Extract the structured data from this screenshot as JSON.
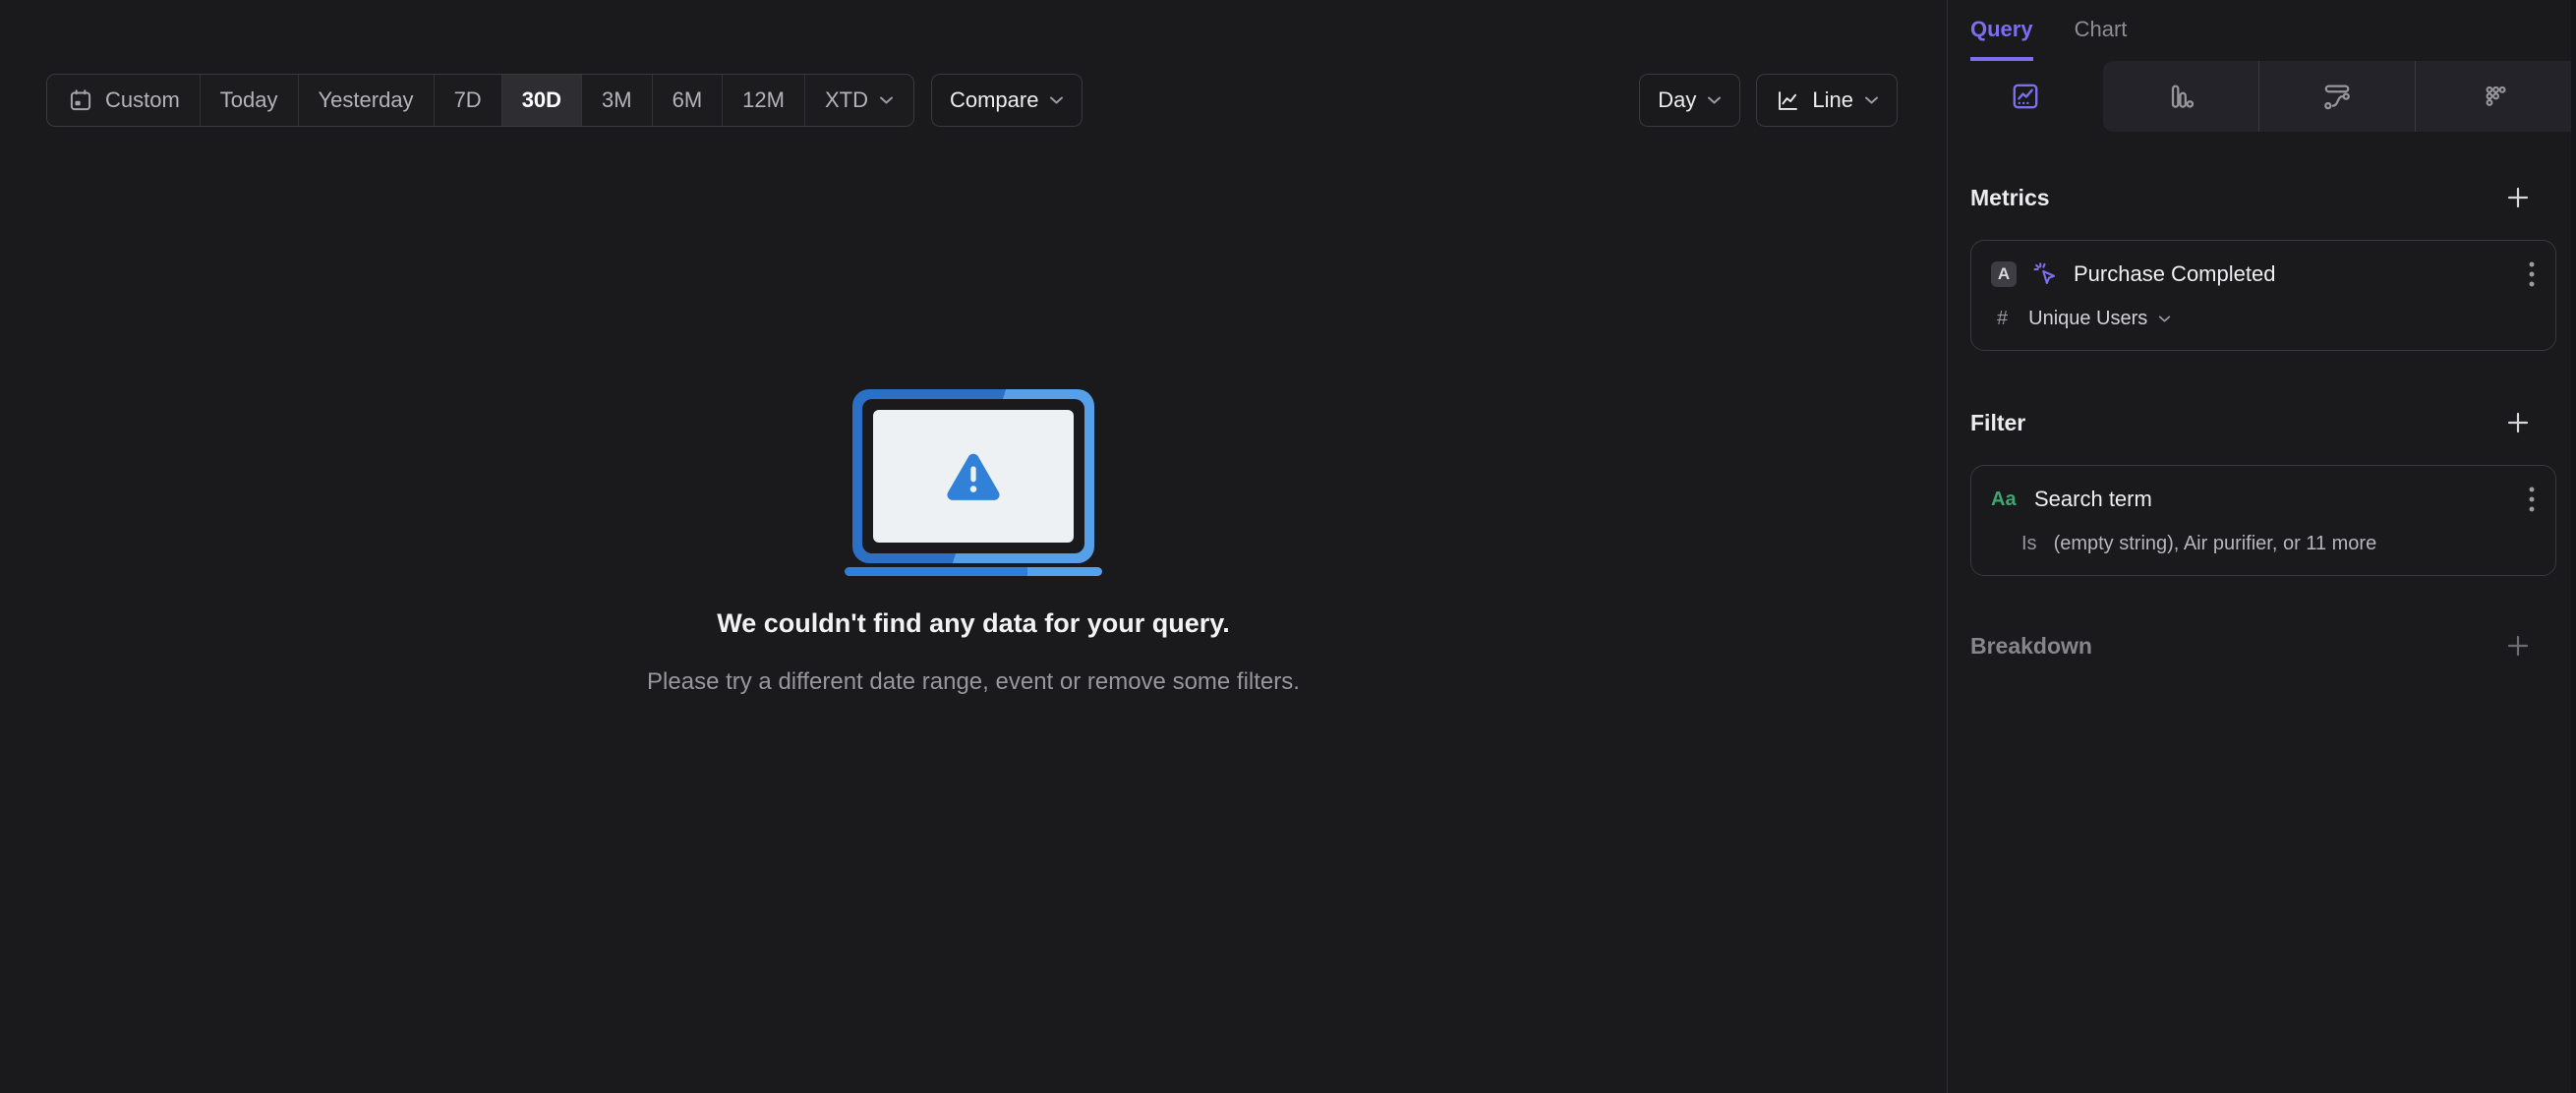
{
  "colors": {
    "accent_purple": "#7b6ff0",
    "property_green": "#3fa573",
    "illustration_blue": "#2f7ed8",
    "illustration_blue_light": "#55a0e8",
    "background": "#1a191c"
  },
  "toolbar": {
    "ranges": [
      {
        "label": "Custom"
      },
      {
        "label": "Today"
      },
      {
        "label": "Yesterday"
      },
      {
        "label": "7D"
      },
      {
        "label": "30D"
      },
      {
        "label": "3M"
      },
      {
        "label": "6M"
      },
      {
        "label": "12M"
      },
      {
        "label": "XTD"
      }
    ],
    "active_range": "30D",
    "compare": {
      "label": "Compare"
    },
    "granularity": {
      "label": "Day"
    },
    "chart_type": {
      "label": "Line"
    }
  },
  "empty_state": {
    "title": "We couldn't find any data for your query.",
    "subtitle": "Please try a different date range, event or remove some filters."
  },
  "sidebar": {
    "tabs": [
      {
        "label": "Query"
      },
      {
        "label": "Chart"
      }
    ],
    "active_tab": "Query",
    "report_tabs": [
      {
        "name": "insights",
        "active": true
      },
      {
        "name": "funnels",
        "active": false
      },
      {
        "name": "flows",
        "active": false
      },
      {
        "name": "retention",
        "active": false
      }
    ],
    "metrics": {
      "heading": "Metrics",
      "add_label": "+",
      "items": [
        {
          "series_letter": "A",
          "event_name": "Purchase Completed",
          "aggregation_symbol": "#",
          "aggregation": "Unique Users"
        }
      ]
    },
    "filter": {
      "heading": "Filter",
      "add_label": "+",
      "items": [
        {
          "type_label": "Aa",
          "property": "Search term",
          "operator": "Is",
          "values_summary": "(empty string), Air purifier, or 11 more"
        }
      ]
    },
    "breakdown": {
      "heading": "Breakdown",
      "add_label": "+"
    }
  }
}
